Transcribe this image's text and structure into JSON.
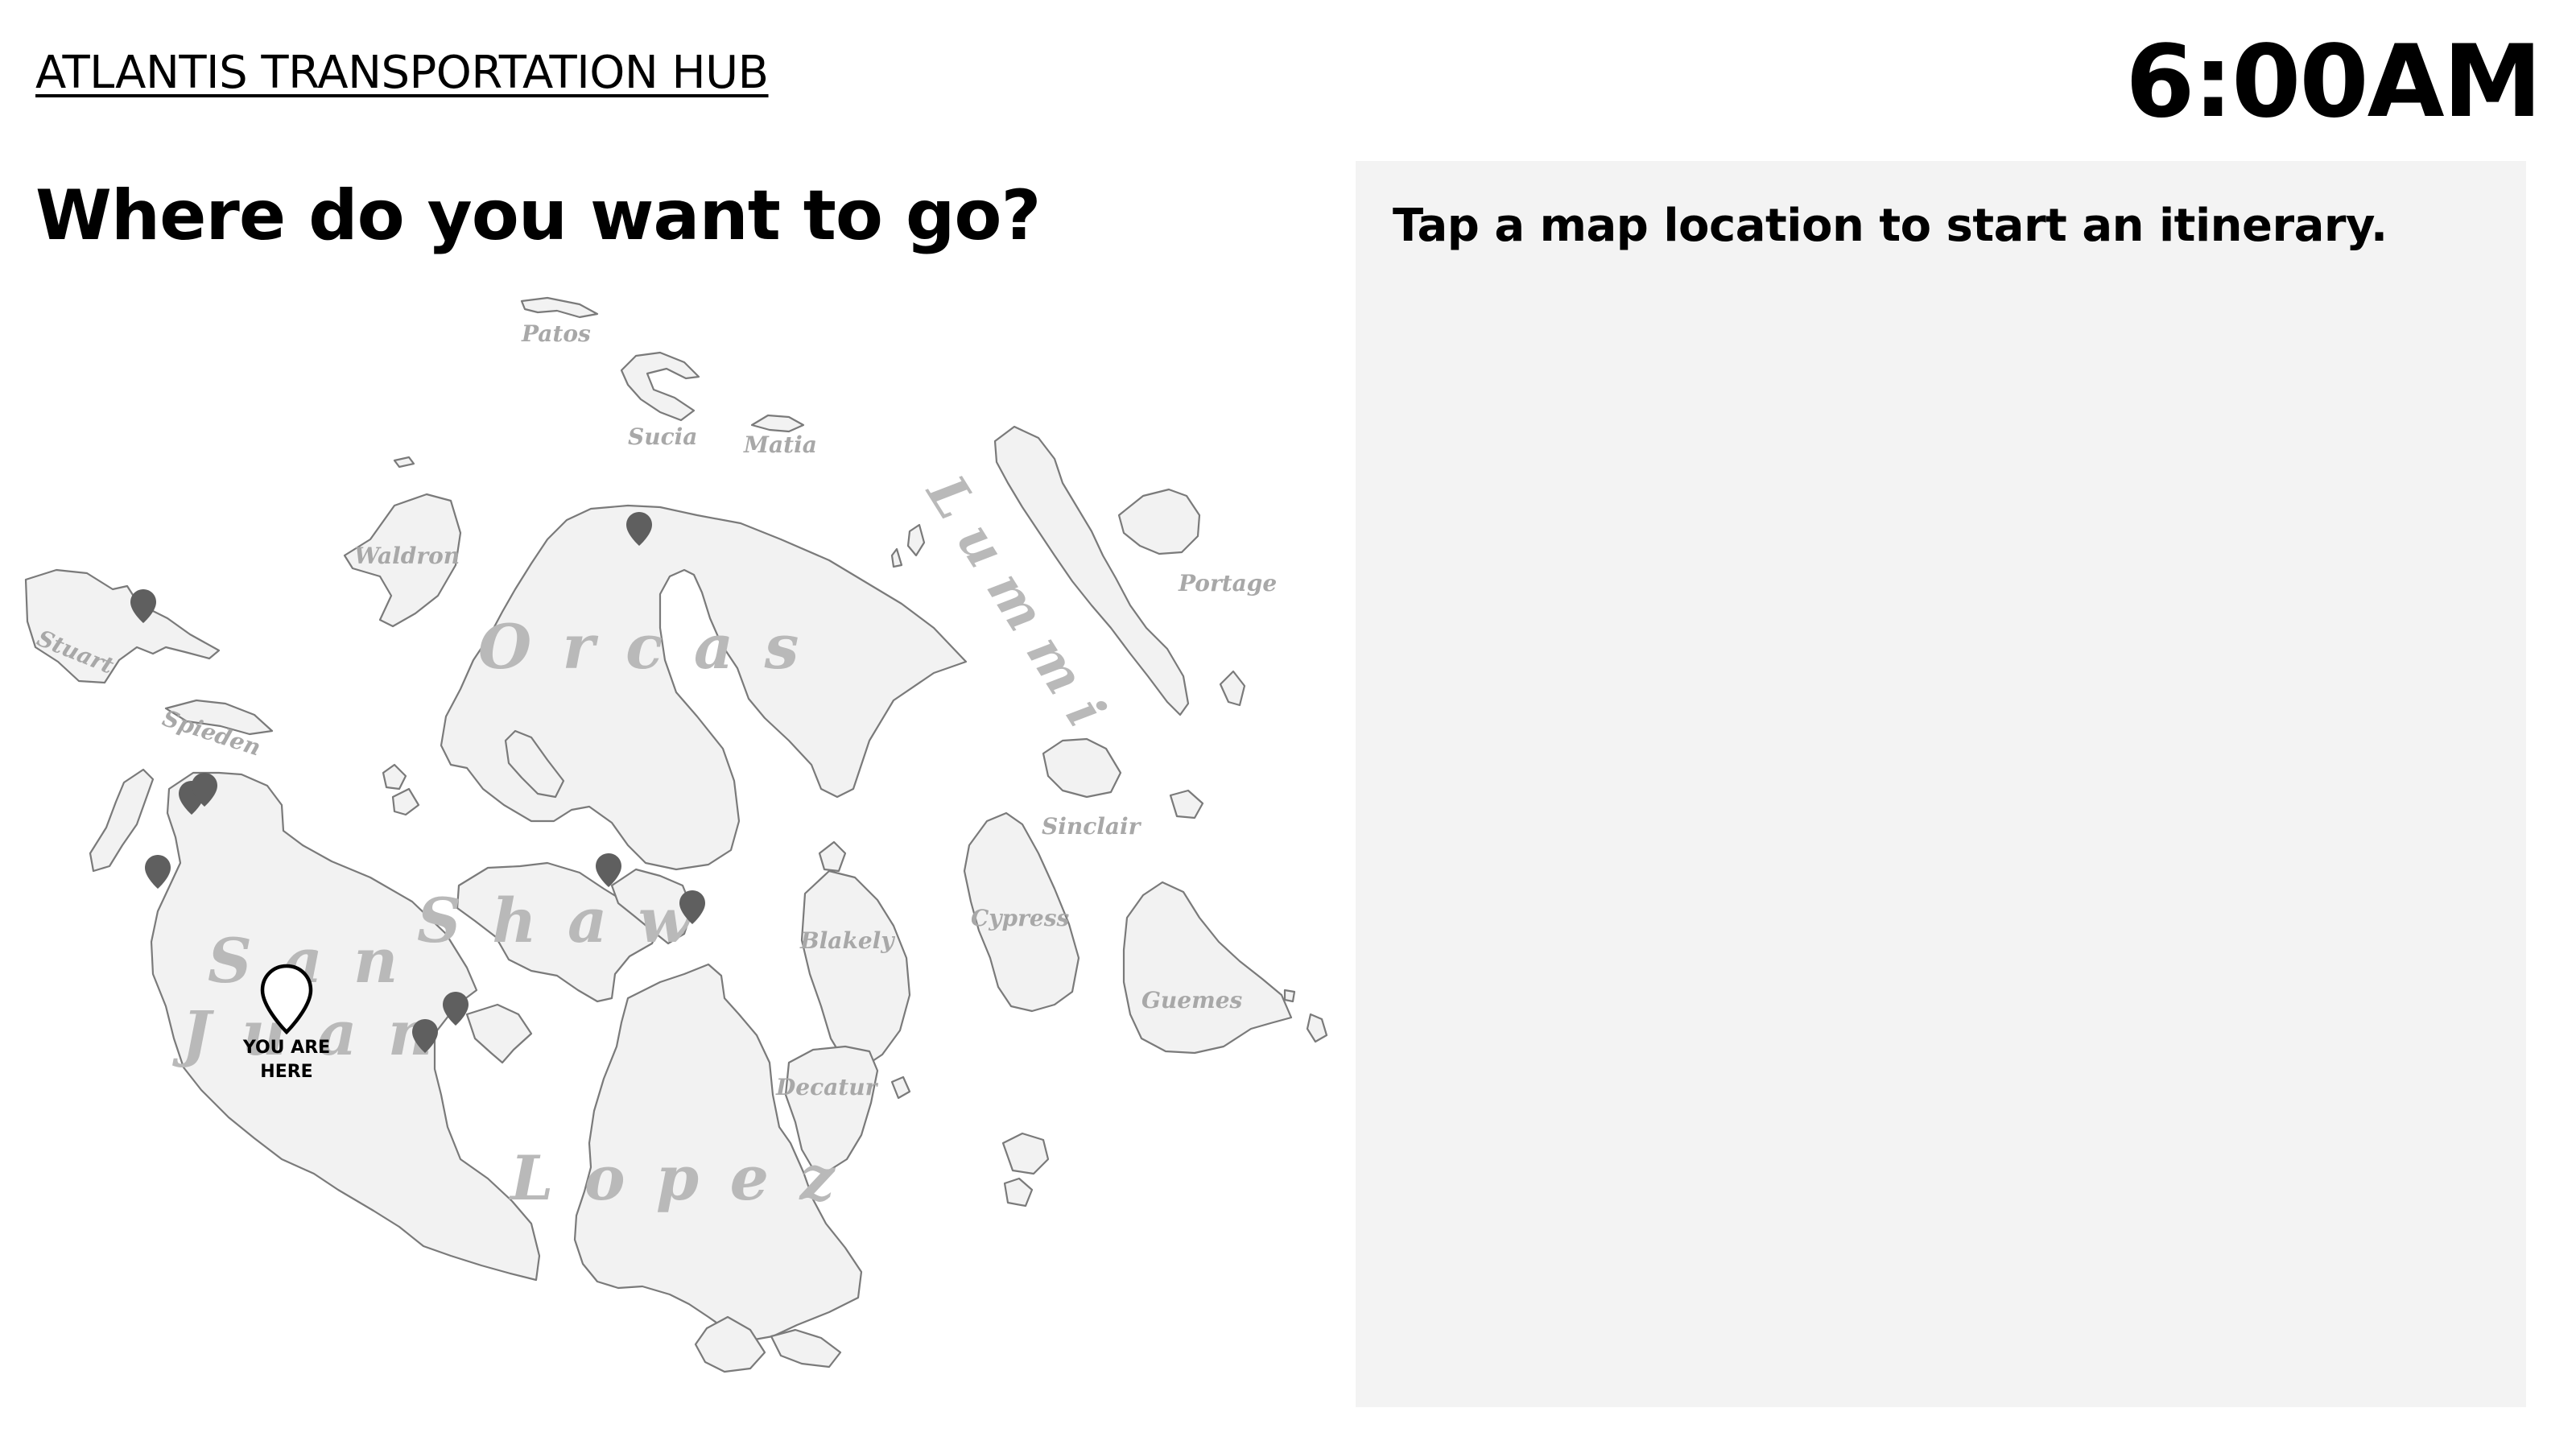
{
  "header": {
    "hub_title": "ATLANTIS TRANSPORTATION HUB",
    "clock": "6:00AM",
    "question": "Where do you want to go?"
  },
  "map": {
    "island_labels": {
      "patos": "Patos",
      "sucia": "Sucia",
      "matia": "Matia",
      "waldron": "Waldron",
      "stuart": "Stuart",
      "spieden": "Spieden",
      "orcas": "O r c a s",
      "lummi": "L u m m i",
      "portage": "Portage",
      "sinclair": "Sinclair",
      "cypress": "Cypress",
      "blakely": "Blakely",
      "guemes": "Guemes",
      "decatur": "Decatur",
      "shaw": "S h a w",
      "san": "S a n",
      "juan": "J u a n",
      "lopez": "L o p e z"
    },
    "you_are_here_line1": "YOU ARE",
    "you_are_here_line2": "HERE",
    "colors": {
      "land": "#f2f2f2",
      "coast": "#7a7a7a",
      "pin": "#5f5f5f"
    }
  },
  "panel": {
    "hint": "Tap a map location to start an itinerary."
  }
}
